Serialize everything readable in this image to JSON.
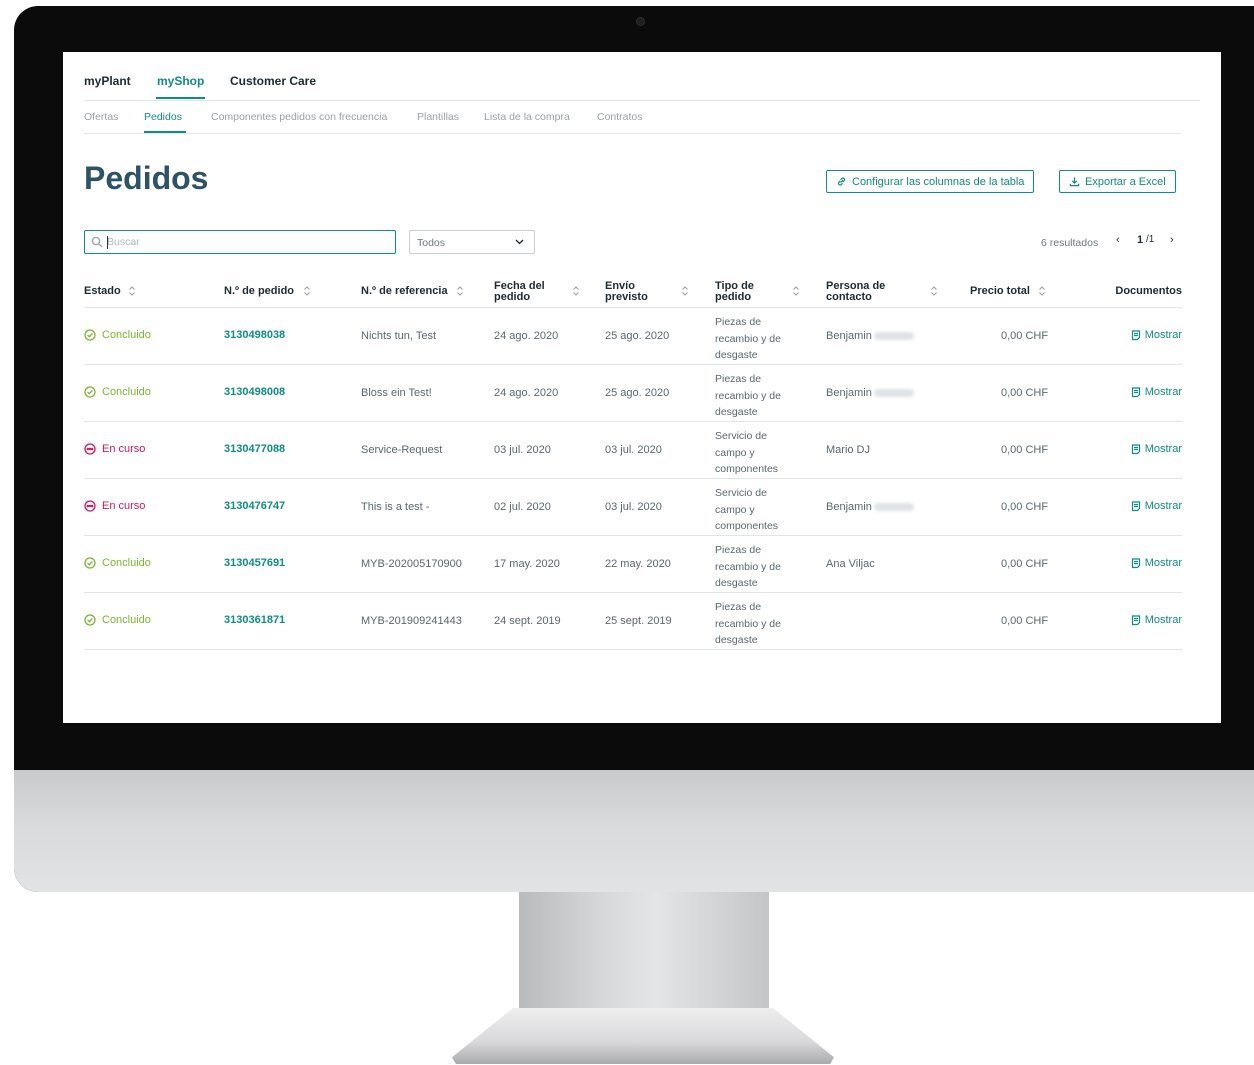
{
  "top_nav": [
    {
      "label": "myPlant",
      "active": false
    },
    {
      "label": "myShop",
      "active": true
    },
    {
      "label": "Customer Care",
      "active": false
    }
  ],
  "sub_nav": [
    {
      "label": "Ofertas",
      "active": false
    },
    {
      "label": "Pedidos",
      "active": true
    },
    {
      "label": "Componentes pedidos con frecuencia",
      "active": false
    },
    {
      "label": "Plantillas",
      "active": false
    },
    {
      "label": "Lista de la compra",
      "active": false
    },
    {
      "label": "Contratos",
      "active": false
    }
  ],
  "page": {
    "title": "Pedidos",
    "configure_button": "Configurar las columnas de la tabla",
    "export_button": "Exportar a Excel"
  },
  "filters": {
    "search_placeholder": "Buscar",
    "status_select": "Todos",
    "results": "6 resultados",
    "page_current": "1",
    "page_total": "/1"
  },
  "table": {
    "headers": {
      "status": "Estado",
      "order_no": "N.º de pedido",
      "ref_no": "N.º de referencia",
      "order_date_1": "Fecha del",
      "order_date_2": "pedido",
      "ship_1": "Envío",
      "ship_2": "previsto",
      "type_1": "Tipo de",
      "type_2": "pedido",
      "contact_1": "Persona de",
      "contact_2": "contacto",
      "total": "Precio total",
      "docs": "Documentos"
    },
    "rows": [
      {
        "status": "Concluido",
        "state": "done",
        "order": "3130498038",
        "ref": "Nichts tun, Test",
        "date": "24 ago. 2020",
        "ship": "25 ago. 2020",
        "type": [
          "Piezas de",
          "recambio y de",
          "desgaste"
        ],
        "contact": "Benjamin",
        "contact_blurred": true,
        "total": "0,00 CHF",
        "doc": "Mostrar"
      },
      {
        "status": "Concluido",
        "state": "done",
        "order": "3130498008",
        "ref": "Bloss ein Test!",
        "date": "24 ago. 2020",
        "ship": "25 ago. 2020",
        "type": [
          "Piezas de",
          "recambio y de",
          "desgaste"
        ],
        "contact": "Benjamin",
        "contact_blurred": true,
        "total": "0,00 CHF",
        "doc": "Mostrar"
      },
      {
        "status": "En curso",
        "state": "prog",
        "order": "3130477088",
        "ref": "Service-Request",
        "date": "03 jul. 2020",
        "ship": "03 jul. 2020",
        "type": [
          "Servicio de",
          "campo y",
          "componentes"
        ],
        "contact": "Mario DJ",
        "contact_blurred": false,
        "total": "0,00 CHF",
        "doc": "Mostrar"
      },
      {
        "status": "En curso",
        "state": "prog",
        "order": "3130476747",
        "ref": "This is a test -",
        "date": "02 jul. 2020",
        "ship": "03 jul. 2020",
        "type": [
          "Servicio de",
          "campo y",
          "componentes"
        ],
        "contact": "Benjamin",
        "contact_blurred": true,
        "total": "0,00 CHF",
        "doc": "Mostrar"
      },
      {
        "status": "Concluido",
        "state": "done",
        "order": "3130457691",
        "ref": "MYB-202005170900",
        "date": "17 may. 2020",
        "ship": "22 may. 2020",
        "type": [
          "Piezas de",
          "recambio y de",
          "desgaste"
        ],
        "contact": "Ana Viljac",
        "contact_blurred": false,
        "total": "0,00 CHF",
        "doc": "Mostrar"
      },
      {
        "status": "Concluido",
        "state": "done",
        "order": "3130361871",
        "ref": "MYB-201909241443",
        "date": "24 sept. 2019",
        "ship": "25 sept. 2019",
        "type": [
          "Piezas de",
          "recambio y de",
          "desgaste"
        ],
        "contact": "",
        "contact_blurred": false,
        "total": "0,00 CHF",
        "doc": "Mostrar"
      }
    ]
  },
  "colors": {
    "accent": "#0f8f7f",
    "title": "#2d5366",
    "status_done": "#7cb82f",
    "status_in_progress": "#d4185b"
  },
  "icons": {
    "search": "search-icon",
    "link": "link-icon",
    "download": "download-icon",
    "sort": "sort-icon",
    "check": "check-circle-icon",
    "progress": "dots-circle-icon",
    "document": "document-icon"
  }
}
